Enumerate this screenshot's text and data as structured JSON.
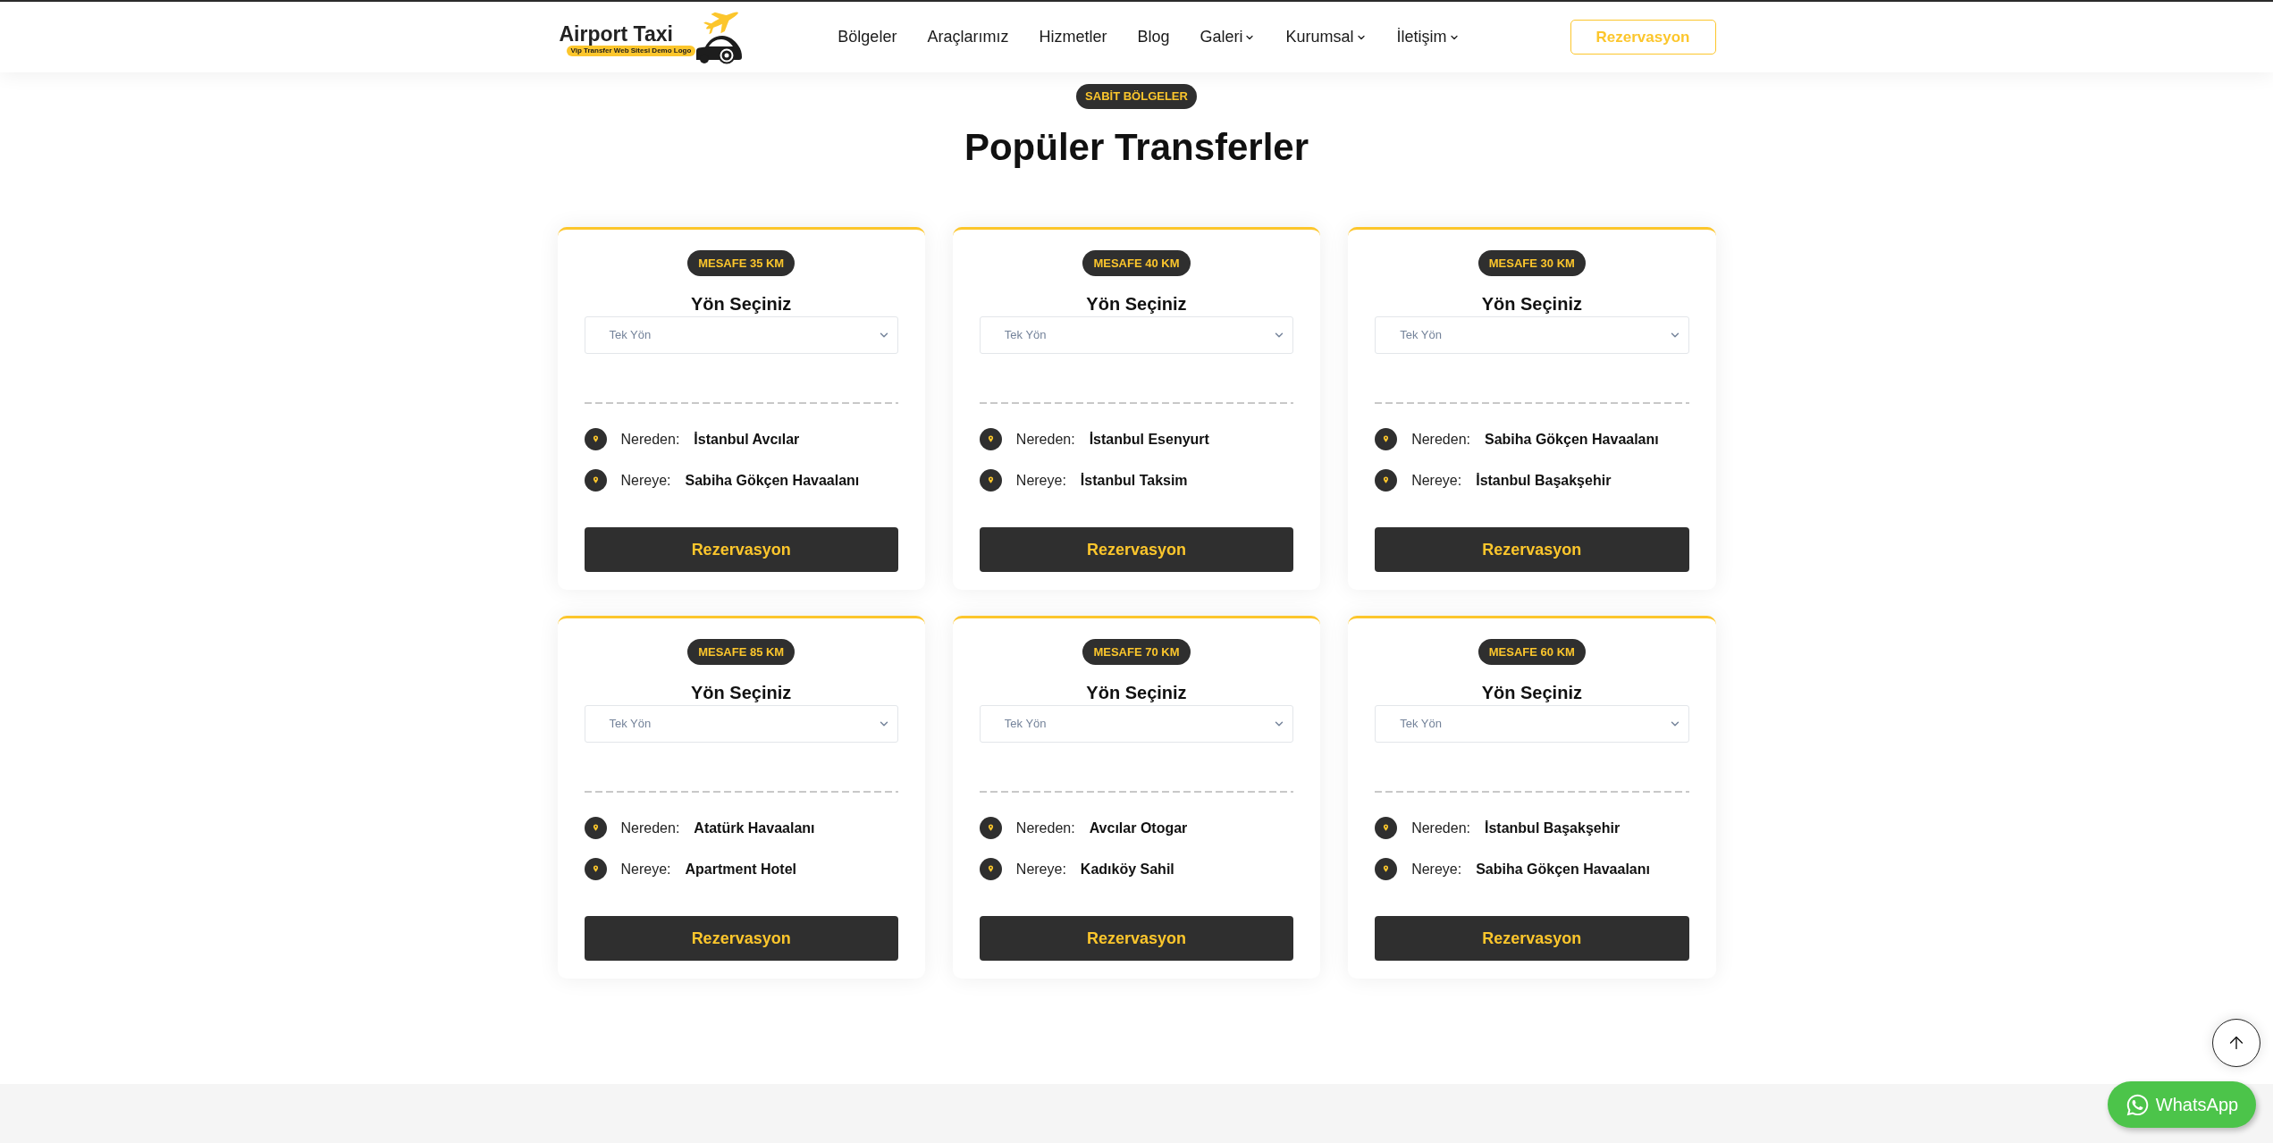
{
  "header": {
    "logo": {
      "title": "Airport Taxi",
      "tagline": "Vip Transfer Web Sitesi Demo Logo"
    },
    "nav": [
      {
        "label": "Bölgeler",
        "dropdown": false
      },
      {
        "label": "Araçlarımız",
        "dropdown": false
      },
      {
        "label": "Hizmetler",
        "dropdown": false
      },
      {
        "label": "Blog",
        "dropdown": false
      },
      {
        "label": "Galeri",
        "dropdown": true
      },
      {
        "label": "Kurumsal",
        "dropdown": true
      },
      {
        "label": "İletişim",
        "dropdown": true
      }
    ],
    "cta": "Rezervasyon"
  },
  "section": {
    "badge": "SABİT BÖLGELER",
    "title": "Popüler Transferler"
  },
  "cards": [
    {
      "distance": "MESAFE 35 KM",
      "heading": "Yön Seçiniz",
      "direction": "Tek Yön",
      "route": [
        {
          "label": "Nereden:",
          "value": "İstanbul Avcılar"
        },
        {
          "label": "Nereye:",
          "value": "Sabiha Gökçen Havaalanı"
        }
      ],
      "button": "Rezervasyon"
    },
    {
      "distance": "MESAFE 40 KM",
      "heading": "Yön Seçiniz",
      "direction": "Tek Yön",
      "route": [
        {
          "label": "Nereden:",
          "value": "İstanbul Esenyurt"
        },
        {
          "label": "Nereye:",
          "value": "İstanbul Taksim"
        }
      ],
      "button": "Rezervasyon"
    },
    {
      "distance": "MESAFE 30 KM",
      "heading": "Yön Seçiniz",
      "direction": "Tek Yön",
      "route": [
        {
          "label": "Nereden:",
          "value": "Sabiha Gökçen Havaalanı"
        },
        {
          "label": "Nereye:",
          "value": "İstanbul Başakşehir"
        }
      ],
      "button": "Rezervasyon"
    },
    {
      "distance": "MESAFE 85 KM",
      "heading": "Yön Seçiniz",
      "direction": "Tek Yön",
      "route": [
        {
          "label": "Nereden:",
          "value": "Atatürk Havaalanı"
        },
        {
          "label": "Nereye:",
          "value": "Apartment Hotel"
        }
      ],
      "button": "Rezervasyon"
    },
    {
      "distance": "MESAFE 70 KM",
      "heading": "Yön Seçiniz",
      "direction": "Tek Yön",
      "route": [
        {
          "label": "Nereden:",
          "value": "Avcılar Otogar"
        },
        {
          "label": "Nereye:",
          "value": "Kadıköy Sahil"
        }
      ],
      "button": "Rezervasyon"
    },
    {
      "distance": "MESAFE 60 KM",
      "heading": "Yön Seçiniz",
      "direction": "Tek Yön",
      "route": [
        {
          "label": "Nereden:",
          "value": "İstanbul Başakşehir"
        },
        {
          "label": "Nereye:",
          "value": "Sabiha Gökçen Havaalanı"
        }
      ],
      "button": "Rezervasyon"
    }
  ],
  "floating": {
    "whatsapp": "WhatsApp"
  }
}
